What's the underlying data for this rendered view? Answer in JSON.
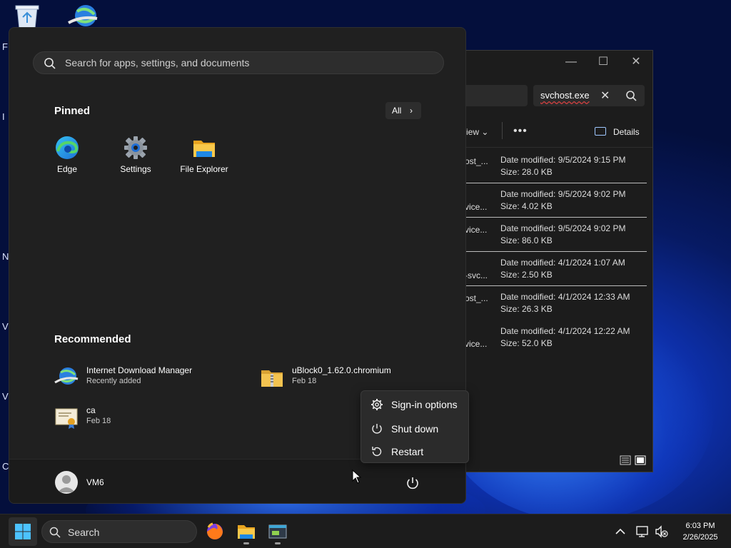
{
  "start_menu": {
    "search_placeholder": "Search for apps, settings, and documents",
    "pinned_title": "Pinned",
    "all_label": "All",
    "pinned": [
      {
        "label": "Edge",
        "icon": "edge-icon"
      },
      {
        "label": "Settings",
        "icon": "settings-gear-icon"
      },
      {
        "label": "File Explorer",
        "icon": "folder-icon"
      }
    ],
    "recommended_title": "Recommended",
    "recommended": [
      {
        "name": "Internet Download Manager",
        "sub": "Recently added",
        "icon": "idm-globe-icon"
      },
      {
        "name": "uBlock0_1.62.0.chromium",
        "sub": "Feb 18",
        "icon": "zip-folder-icon"
      },
      {
        "name": "ca",
        "sub": "Feb 18",
        "icon": "certificate-icon"
      }
    ],
    "user_name": "VM6",
    "power_menu": [
      {
        "label": "Sign-in options",
        "icon": "gear-icon"
      },
      {
        "label": "Shut down",
        "icon": "power-icon"
      },
      {
        "label": "Restart",
        "icon": "restart-icon"
      }
    ]
  },
  "explorer": {
    "search_value": "svchost.exe",
    "view_label": "iew",
    "details_label": "Details",
    "files": [
      {
        "name": "ost_...",
        "date": "Date modified: 9/5/2024 9:15 PM",
        "size": "Size: 28.0 KB"
      },
      {
        "name": "vice...",
        "date": "Date modified: 9/5/2024 9:02 PM",
        "size": "Size: 4.02 KB"
      },
      {
        "name": "vice...",
        "date": "Date modified: 9/5/2024 9:02 PM",
        "size": "Size: 86.0 KB"
      },
      {
        "name": "-svc...",
        "date": "Date modified: 4/1/2024 1:07 AM",
        "size": "Size: 2.50 KB"
      },
      {
        "name": "ost_...",
        "date": "Date modified: 4/1/2024 12:33 AM",
        "size": "Size: 26.3 KB"
      },
      {
        "name": "vice...",
        "date": "Date modified: 4/1/2024 12:22 AM",
        "size": "Size: 52.0 KB"
      }
    ]
  },
  "desktop": {
    "edge_letters": [
      "F",
      "I",
      "N",
      "V",
      "V",
      "C"
    ]
  },
  "taskbar": {
    "search_label": "Search",
    "time": "6:03 PM",
    "date": "2/26/2025"
  },
  "colors": {
    "accent": "#0078d4",
    "menu_bg": "#202020",
    "folder_yellow": "#f5c242"
  }
}
